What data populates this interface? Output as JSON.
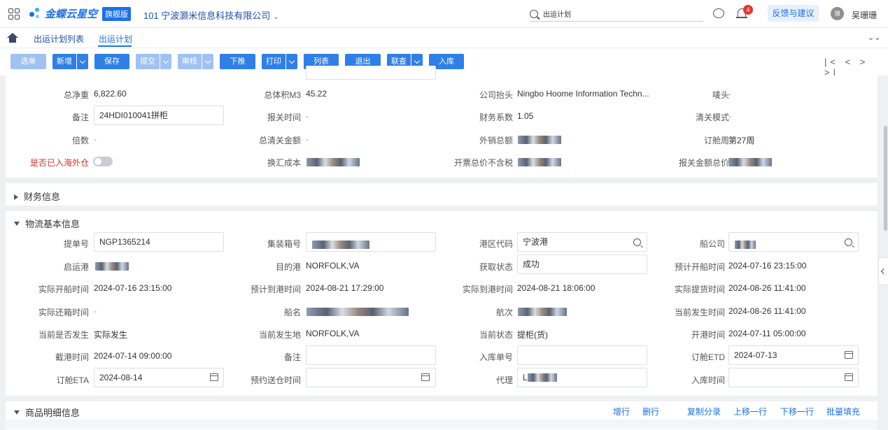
{
  "top": {
    "logo_text": "金蝶云星空",
    "edition": "旗舰版",
    "company": "101 宁波灏米信息科技有限公司",
    "search_value": "出运计划",
    "notif_count": "4",
    "feedback": "反馈与建议",
    "avatar": "珊",
    "user": "吴珊珊"
  },
  "tabs": [
    "出运计划列表",
    "出运计划"
  ],
  "toolbar": {
    "buttons": [
      "选单",
      "新增",
      "保存",
      "提交",
      "审核",
      "下推",
      "打印",
      "列表",
      "退出",
      "联查",
      "入库"
    ],
    "pager": "|< < > >|"
  },
  "summary": {
    "r1": {
      "l1": "总净重",
      "v1": "6,822.60",
      "l2": "总体积M3",
      "v2": "45.22",
      "l3": "公司抬头",
      "v3": "Ningbo Hoome Information Techn...",
      "l4": "唛头",
      "v4": "-"
    },
    "r2": {
      "l1": "备注",
      "v1": "24HDI010041拼柜",
      "l2": "报关时间",
      "v2": "-",
      "l3": "财务系数",
      "v3": "1.05",
      "l4": "清关模式",
      "v4": "-"
    },
    "r3": {
      "l1": "倍数",
      "v1": "-",
      "l2": "总清关金额",
      "v2": "-",
      "l3": "外销总额",
      "l4": "订舱周",
      "v4": "第27周"
    },
    "r4": {
      "l1": "是否已入海外仓",
      "l2": "换汇成本",
      "l3": "开票总价不含税",
      "l4": "报关金额总价"
    }
  },
  "finance": {
    "title": "财务信息"
  },
  "logistics": {
    "title": "物流基本信息",
    "r1": {
      "l1": "提单号",
      "v1": "NGP1365214",
      "l2": "集装箱号",
      "l3": "港区代码",
      "v3": "宁波港",
      "l4": "船公司"
    },
    "r2": {
      "l1": "启运港",
      "l2": "目的港",
      "v2": "NORFOLK,VA",
      "l3": "获取状态",
      "v3": "成功",
      "l4": "预计开船时间",
      "v4": "2024-07-16 23:15:00"
    },
    "r3": {
      "l1": "实际开船时间",
      "v1": "2024-07-16 23:15:00",
      "l2": "预计到港时间",
      "v2": "2024-08-21 17:29:00",
      "l3": "实际到港时间",
      "v3": "2024-08-21 18:06:00",
      "l4": "实际提货时间",
      "v4": "2024-08-26 11:41:00"
    },
    "r4": {
      "l1": "实际还箱时间",
      "v1": "-",
      "l2": "船名",
      "l3": "航次",
      "l4": "当前发生时间",
      "v4": "2024-08-26 11:41:00"
    },
    "r5": {
      "l1": "当前是否发生",
      "v1": "实际发生",
      "l2": "当前发生地",
      "v2": "NORFOLK,VA",
      "l3": "当前状态",
      "v3": "提柜(货)",
      "l4": "开港时间",
      "v4": "2024-07-11 05:00:00"
    },
    "r6": {
      "l1": "截港时间",
      "v1": "2024-07-14 09:00:00",
      "l2": "备注",
      "l3": "入库单号",
      "l4": "订舱ETD",
      "v4": "2024-07-13"
    },
    "r7": {
      "l1": "订舱ETA",
      "v1": "2024-08-14",
      "l2": "预约送仓时间",
      "l3": "代理",
      "v3": "L",
      "l4": "入库时间"
    }
  },
  "goods": {
    "title": "商品明细信息",
    "actions": [
      "增行",
      "删行",
      "复制分录",
      "上移一行",
      "下移一行",
      "批量填充"
    ]
  },
  "colors": {
    "accent": "#2f7fe8",
    "danger": "#d0342c",
    "link": "#1d70e8"
  }
}
